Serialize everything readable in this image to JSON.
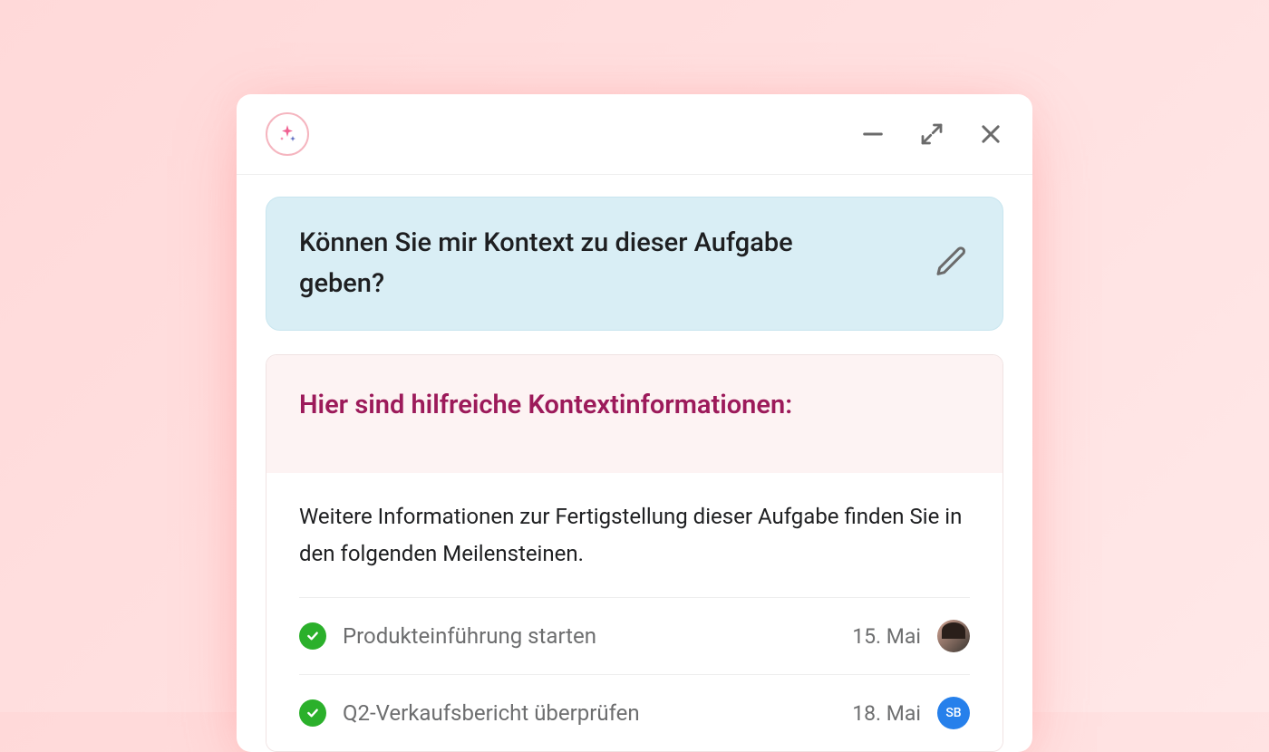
{
  "prompt": {
    "text": "Können Sie mir Kontext zu dieser Aufgabe geben?"
  },
  "response": {
    "title": "Hier sind hilfreiche Kontextinformationen:",
    "description": "Weitere Informationen zur Fertigstellung dieser Aufgabe finden Sie in den folgenden Meilensteinen."
  },
  "tasks": [
    {
      "title": "Produkteinführung starten",
      "date": "15. Mai",
      "assignee_type": "photo",
      "assignee_initials": ""
    },
    {
      "title": "Q2-Verkaufsbericht überprüfen",
      "date": "18. Mai",
      "assignee_type": "initials",
      "assignee_initials": "SB"
    }
  ]
}
